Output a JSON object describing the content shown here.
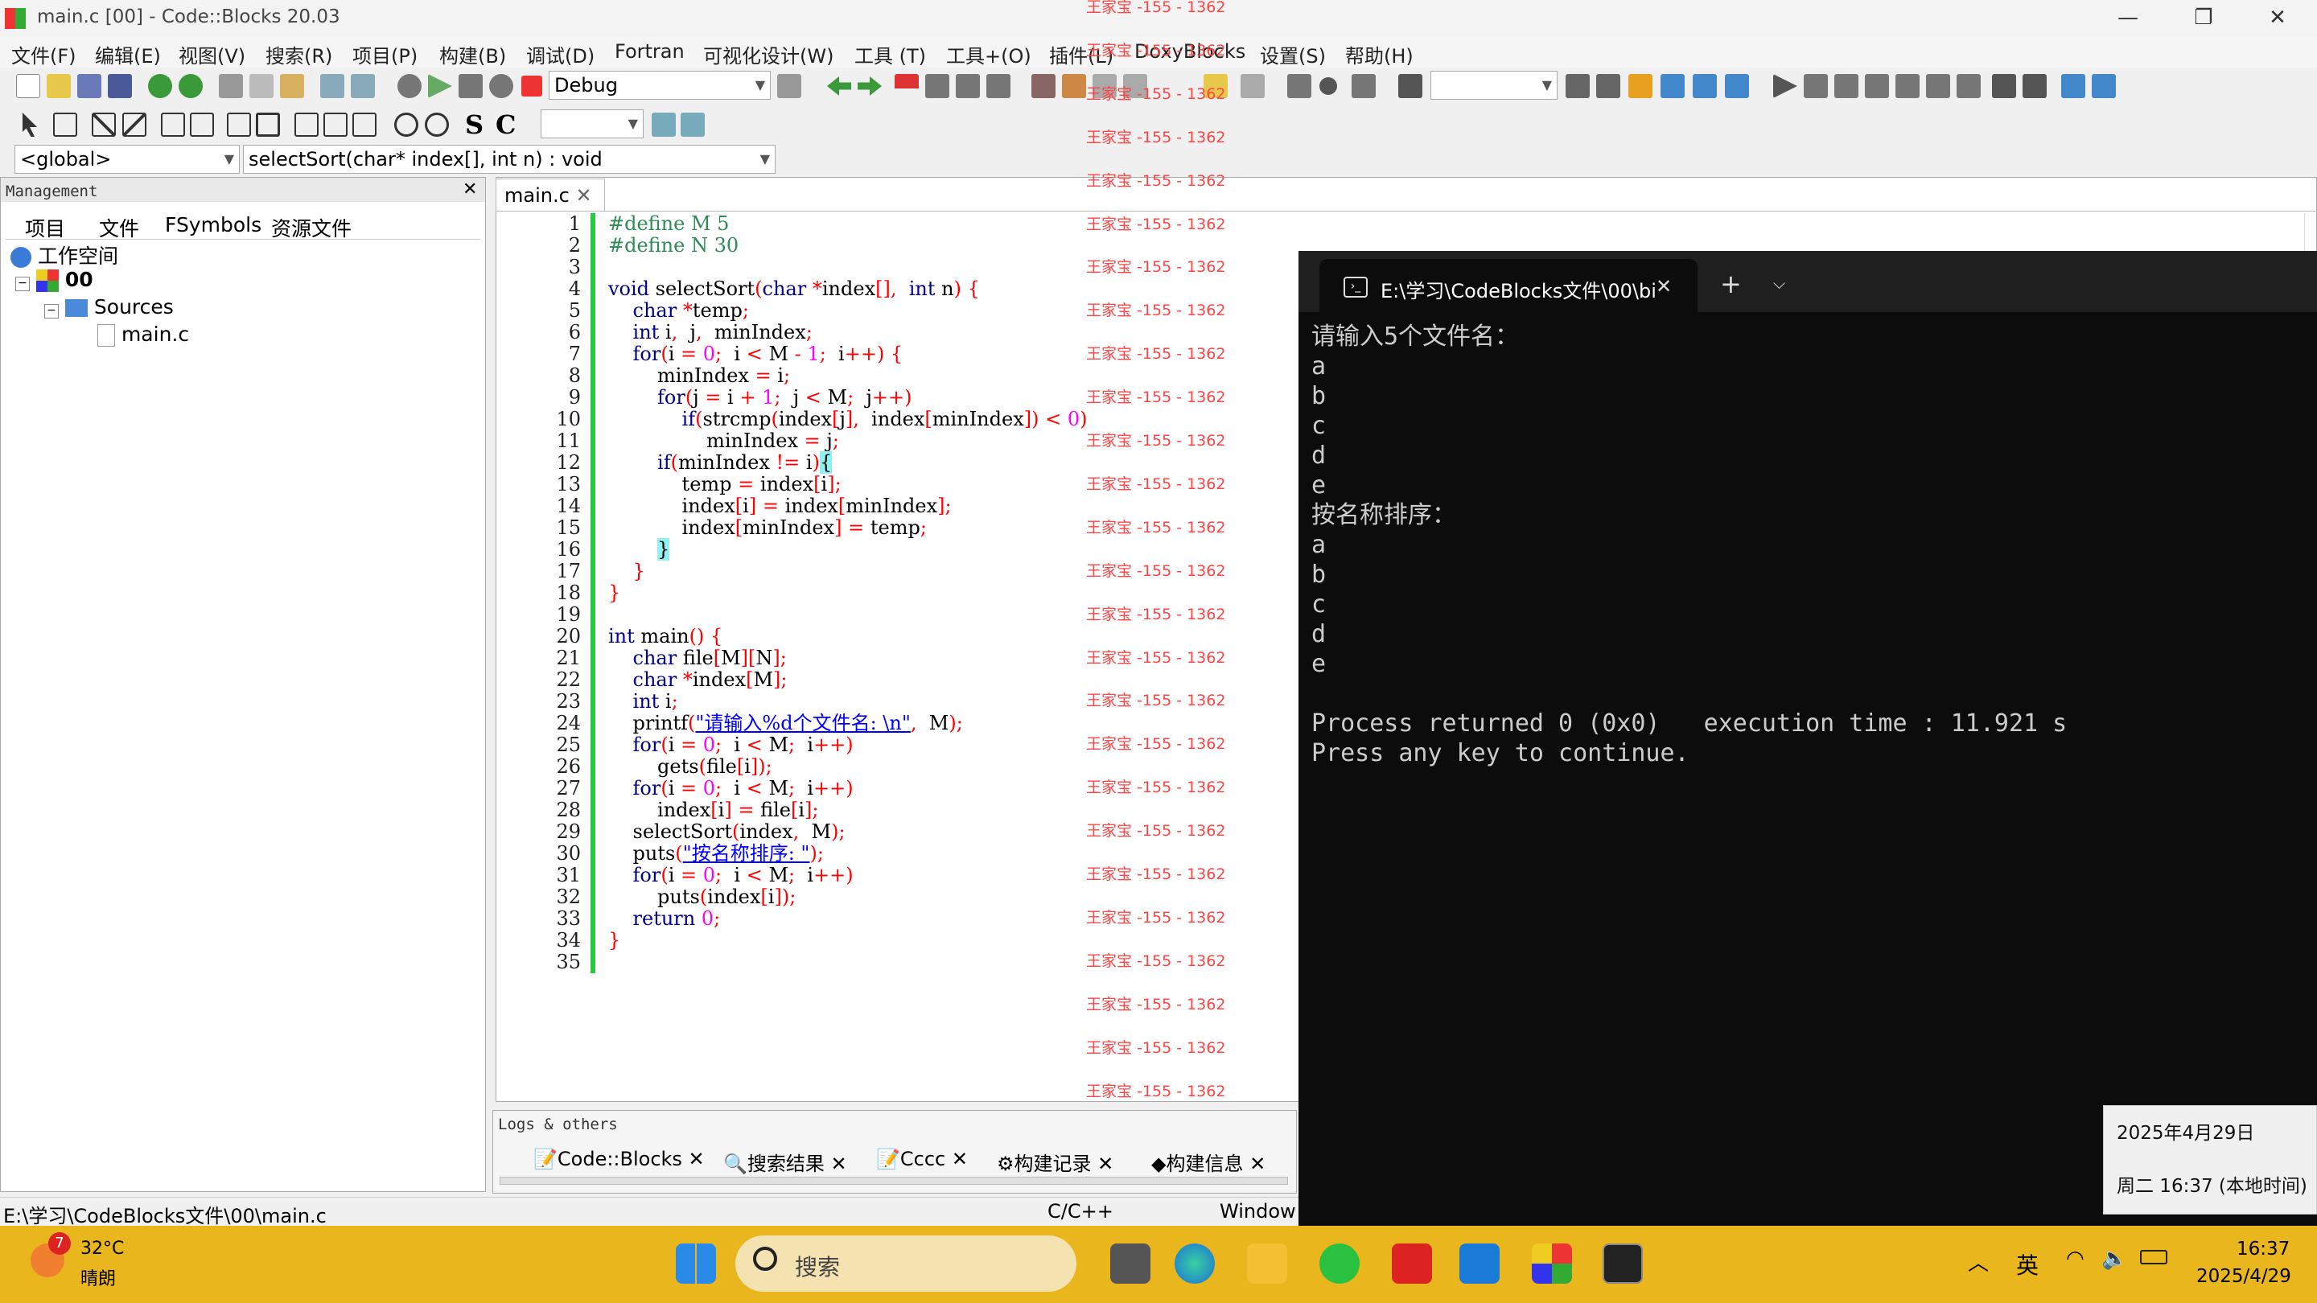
{
  "window": {
    "title": "main.c [00] - Code::Blocks 20.03"
  },
  "menu": [
    "文件(F)",
    "编辑(E)",
    "视图(V)",
    "搜索(R)",
    "项目(P)",
    "构建(B)",
    "调试(D)",
    "Fortran",
    "可视化设计(W)",
    "工具 (T)",
    "工具+(O)",
    "插件(L)",
    "DoxyBlocks",
    "设置(S)",
    "帮助(H)"
  ],
  "toolbar": {
    "build_target": "Debug",
    "scope": "<global>",
    "function": "selectSort(char* index[], int n) : void",
    "letters": [
      "S",
      "C"
    ]
  },
  "management": {
    "title": "Management",
    "tabs": [
      "项目",
      "文件",
      "FSymbols",
      "资源文件"
    ],
    "workspace": "工作空间",
    "project": "00",
    "folder": "Sources",
    "file": "main.c"
  },
  "editor": {
    "tab": "main.c"
  },
  "code_lines": [
    [
      [
        "pp",
        "#define M 5"
      ]
    ],
    [
      [
        "pp",
        "#define N 30"
      ]
    ],
    [
      [
        "plain",
        ""
      ]
    ],
    [
      [
        "kw",
        "void"
      ],
      [
        "plain",
        " selectSort"
      ],
      [
        "op",
        "("
      ],
      [
        "kw",
        "char"
      ],
      [
        "plain",
        " "
      ],
      [
        "op",
        "*"
      ],
      [
        "plain",
        "index"
      ],
      [
        "op",
        "[],"
      ],
      [
        "plain",
        "  "
      ],
      [
        "kw",
        "int"
      ],
      [
        "plain",
        " n"
      ],
      [
        "op",
        ")"
      ],
      [
        "plain",
        " "
      ],
      [
        "op",
        "{"
      ]
    ],
    [
      [
        "plain",
        "    "
      ],
      [
        "kw",
        "char"
      ],
      [
        "plain",
        " "
      ],
      [
        "op",
        "*"
      ],
      [
        "plain",
        "temp"
      ],
      [
        "op",
        ";"
      ]
    ],
    [
      [
        "plain",
        "    "
      ],
      [
        "kw",
        "int"
      ],
      [
        "plain",
        " i"
      ],
      [
        "op",
        ","
      ],
      [
        "plain",
        "  j"
      ],
      [
        "op",
        ","
      ],
      [
        "plain",
        "  minIndex"
      ],
      [
        "op",
        ";"
      ]
    ],
    [
      [
        "plain",
        "    "
      ],
      [
        "kw",
        "for"
      ],
      [
        "op",
        "("
      ],
      [
        "plain",
        "i "
      ],
      [
        "op",
        "="
      ],
      [
        "plain",
        " "
      ],
      [
        "nm",
        "0"
      ],
      [
        "op",
        ";"
      ],
      [
        "plain",
        "  i "
      ],
      [
        "op",
        "<"
      ],
      [
        "plain",
        " M "
      ],
      [
        "op",
        "-"
      ],
      [
        "plain",
        " "
      ],
      [
        "nm",
        "1"
      ],
      [
        "op",
        ";"
      ],
      [
        "plain",
        "  i"
      ],
      [
        "op",
        "++)"
      ],
      [
        "plain",
        " "
      ],
      [
        "op",
        "{"
      ]
    ],
    [
      [
        "plain",
        "        minIndex "
      ],
      [
        "op",
        "="
      ],
      [
        "plain",
        " i"
      ],
      [
        "op",
        ";"
      ]
    ],
    [
      [
        "plain",
        "        "
      ],
      [
        "kw",
        "for"
      ],
      [
        "op",
        "("
      ],
      [
        "plain",
        "j "
      ],
      [
        "op",
        "="
      ],
      [
        "plain",
        " i "
      ],
      [
        "op",
        "+"
      ],
      [
        "plain",
        " "
      ],
      [
        "nm",
        "1"
      ],
      [
        "op",
        ";"
      ],
      [
        "plain",
        "  j "
      ],
      [
        "op",
        "<"
      ],
      [
        "plain",
        " M"
      ],
      [
        "op",
        ";"
      ],
      [
        "plain",
        "  j"
      ],
      [
        "op",
        "++)"
      ]
    ],
    [
      [
        "plain",
        "            "
      ],
      [
        "kw",
        "if"
      ],
      [
        "op",
        "("
      ],
      [
        "plain",
        "strcmp"
      ],
      [
        "op",
        "("
      ],
      [
        "plain",
        "index"
      ],
      [
        "op",
        "["
      ],
      [
        "plain",
        "j"
      ],
      [
        "op",
        "],"
      ],
      [
        "plain",
        "  index"
      ],
      [
        "op",
        "["
      ],
      [
        "plain",
        "minIndex"
      ],
      [
        "op",
        "])"
      ],
      [
        "plain",
        " "
      ],
      [
        "op",
        "<"
      ],
      [
        "plain",
        " "
      ],
      [
        "nm",
        "0"
      ],
      [
        "op",
        ")"
      ]
    ],
    [
      [
        "plain",
        "                minIndex "
      ],
      [
        "op",
        "="
      ],
      [
        "plain",
        " j"
      ],
      [
        "op",
        ";"
      ]
    ],
    [
      [
        "plain",
        "        "
      ],
      [
        "kw",
        "if"
      ],
      [
        "op",
        "("
      ],
      [
        "plain",
        "minIndex "
      ],
      [
        "op",
        "!="
      ],
      [
        "plain",
        " i"
      ],
      [
        "op",
        ")"
      ],
      [
        "br",
        "{"
      ]
    ],
    [
      [
        "plain",
        "            temp "
      ],
      [
        "op",
        "="
      ],
      [
        "plain",
        " index"
      ],
      [
        "op",
        "["
      ],
      [
        "plain",
        "i"
      ],
      [
        "op",
        "];"
      ]
    ],
    [
      [
        "plain",
        "            index"
      ],
      [
        "op",
        "["
      ],
      [
        "plain",
        "i"
      ],
      [
        "op",
        "]"
      ],
      [
        "plain",
        " "
      ],
      [
        "op",
        "="
      ],
      [
        "plain",
        " index"
      ],
      [
        "op",
        "["
      ],
      [
        "plain",
        "minIndex"
      ],
      [
        "op",
        "];"
      ]
    ],
    [
      [
        "plain",
        "            index"
      ],
      [
        "op",
        "["
      ],
      [
        "plain",
        "minIndex"
      ],
      [
        "op",
        "]"
      ],
      [
        "plain",
        " "
      ],
      [
        "op",
        "="
      ],
      [
        "plain",
        " temp"
      ],
      [
        "op",
        ";"
      ]
    ],
    [
      [
        "plain",
        "        "
      ],
      [
        "br",
        "}"
      ]
    ],
    [
      [
        "plain",
        "    "
      ],
      [
        "op",
        "}"
      ]
    ],
    [
      [
        "op",
        "}"
      ]
    ],
    [
      [
        "plain",
        ""
      ]
    ],
    [
      [
        "kw",
        "int"
      ],
      [
        "plain",
        " main"
      ],
      [
        "op",
        "()"
      ],
      [
        "plain",
        " "
      ],
      [
        "op",
        "{"
      ]
    ],
    [
      [
        "plain",
        "    "
      ],
      [
        "kw",
        "char"
      ],
      [
        "plain",
        " file"
      ],
      [
        "op",
        "["
      ],
      [
        "plain",
        "M"
      ],
      [
        "op",
        "]["
      ],
      [
        "plain",
        "N"
      ],
      [
        "op",
        "];"
      ]
    ],
    [
      [
        "plain",
        "    "
      ],
      [
        "kw",
        "char"
      ],
      [
        "plain",
        " "
      ],
      [
        "op",
        "*"
      ],
      [
        "plain",
        "index"
      ],
      [
        "op",
        "["
      ],
      [
        "plain",
        "M"
      ],
      [
        "op",
        "];"
      ]
    ],
    [
      [
        "plain",
        "    "
      ],
      [
        "kw",
        "int"
      ],
      [
        "plain",
        " i"
      ],
      [
        "op",
        ";"
      ]
    ],
    [
      [
        "plain",
        "    printf"
      ],
      [
        "op",
        "("
      ],
      [
        "st",
        "\"请输入%d个文件名: \\n\""
      ],
      [
        "op",
        ","
      ],
      [
        "plain",
        "  M"
      ],
      [
        "op",
        ");"
      ]
    ],
    [
      [
        "plain",
        "    "
      ],
      [
        "kw",
        "for"
      ],
      [
        "op",
        "("
      ],
      [
        "plain",
        "i "
      ],
      [
        "op",
        "="
      ],
      [
        "plain",
        " "
      ],
      [
        "nm",
        "0"
      ],
      [
        "op",
        ";"
      ],
      [
        "plain",
        "  i "
      ],
      [
        "op",
        "<"
      ],
      [
        "plain",
        " M"
      ],
      [
        "op",
        ";"
      ],
      [
        "plain",
        "  i"
      ],
      [
        "op",
        "++)"
      ]
    ],
    [
      [
        "plain",
        "        gets"
      ],
      [
        "op",
        "("
      ],
      [
        "plain",
        "file"
      ],
      [
        "op",
        "["
      ],
      [
        "plain",
        "i"
      ],
      [
        "op",
        "]);"
      ]
    ],
    [
      [
        "plain",
        "    "
      ],
      [
        "kw",
        "for"
      ],
      [
        "op",
        "("
      ],
      [
        "plain",
        "i "
      ],
      [
        "op",
        "="
      ],
      [
        "plain",
        " "
      ],
      [
        "nm",
        "0"
      ],
      [
        "op",
        ";"
      ],
      [
        "plain",
        "  i "
      ],
      [
        "op",
        "<"
      ],
      [
        "plain",
        " M"
      ],
      [
        "op",
        ";"
      ],
      [
        "plain",
        "  i"
      ],
      [
        "op",
        "++)"
      ]
    ],
    [
      [
        "plain",
        "        index"
      ],
      [
        "op",
        "["
      ],
      [
        "plain",
        "i"
      ],
      [
        "op",
        "]"
      ],
      [
        "plain",
        " "
      ],
      [
        "op",
        "="
      ],
      [
        "plain",
        " file"
      ],
      [
        "op",
        "["
      ],
      [
        "plain",
        "i"
      ],
      [
        "op",
        "];"
      ]
    ],
    [
      [
        "plain",
        "    selectSort"
      ],
      [
        "op",
        "("
      ],
      [
        "plain",
        "index"
      ],
      [
        "op",
        ","
      ],
      [
        "plain",
        "  M"
      ],
      [
        "op",
        ");"
      ]
    ],
    [
      [
        "plain",
        "    puts"
      ],
      [
        "op",
        "("
      ],
      [
        "st",
        "\"按名称排序: \""
      ],
      [
        "op",
        ");"
      ]
    ],
    [
      [
        "plain",
        "    "
      ],
      [
        "kw",
        "for"
      ],
      [
        "op",
        "("
      ],
      [
        "plain",
        "i "
      ],
      [
        "op",
        "="
      ],
      [
        "plain",
        " "
      ],
      [
        "nm",
        "0"
      ],
      [
        "op",
        ";"
      ],
      [
        "plain",
        "  i "
      ],
      [
        "op",
        "<"
      ],
      [
        "plain",
        " M"
      ],
      [
        "op",
        ";"
      ],
      [
        "plain",
        "  i"
      ],
      [
        "op",
        "++)"
      ]
    ],
    [
      [
        "plain",
        "        puts"
      ],
      [
        "op",
        "("
      ],
      [
        "plain",
        "index"
      ],
      [
        "op",
        "["
      ],
      [
        "plain",
        "i"
      ],
      [
        "op",
        "]);"
      ]
    ],
    [
      [
        "plain",
        "    "
      ],
      [
        "kw",
        "return"
      ],
      [
        "plain",
        " "
      ],
      [
        "nm",
        "0"
      ],
      [
        "op",
        ";"
      ]
    ],
    [
      [
        "op",
        "}"
      ]
    ],
    [
      [
        "plain",
        ""
      ]
    ]
  ],
  "watermark": "王家宝 -155 - 1362",
  "logs": {
    "title": "Logs & others",
    "tabs": [
      "Code::Blocks",
      "搜索结果",
      "Cccc",
      "构建记录",
      "构建信息"
    ]
  },
  "statusbar": {
    "path": "E:\\学习\\CodeBlocks文件\\00\\main.c",
    "lang": "C/C++",
    "eol": "Window"
  },
  "terminal": {
    "tab_title": "E:\\学习\\CodeBlocks文件\\00\\bi",
    "lines": [
      "请输入5个文件名：",
      "a",
      "b",
      "c",
      "d",
      "e",
      "按名称排序：",
      "a",
      "b",
      "c",
      "d",
      "e",
      "",
      "Process returned 0 (0x0)   execution time : 11.921 s",
      "Press any key to continue."
    ]
  },
  "popup": {
    "date": "2025年4月29日",
    "weekday_time": "周二 16:37 (本地时间)"
  },
  "taskbar": {
    "weather_temp": "32°C",
    "weather_desc": "晴朗",
    "weather_badge": "7",
    "search": "搜索",
    "ime": "英",
    "time": "16:37",
    "date": "2025/4/29"
  },
  "colors": {
    "keyword": "#00008b",
    "preprocessor": "#2e8b57",
    "string": "#0000ff",
    "operator": "#ff0000",
    "number": "#ff00ff",
    "changebar": "#27c93f",
    "taskbar": "#e9b61d"
  }
}
